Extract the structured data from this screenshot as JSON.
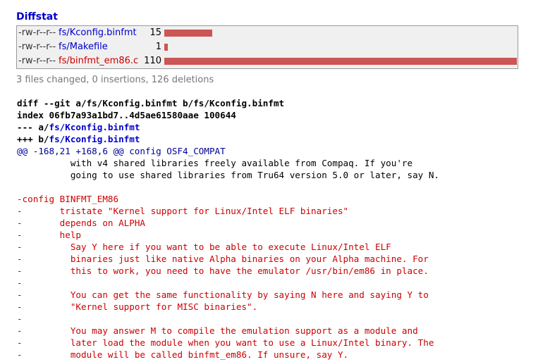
{
  "diffstat": {
    "heading": "Diffstat",
    "max_count": 110,
    "rows": [
      {
        "mode": "-rw-r--r--",
        "file": "fs/Kconfig.binfmt",
        "count": "15",
        "deleted_file": false
      },
      {
        "mode": "-rw-r--r--",
        "file": "fs/Makefile",
        "count": "1",
        "deleted_file": false
      },
      {
        "mode": "-rw-r--r--",
        "file": "fs/binfmt_em86.c",
        "count": "110",
        "deleted_file": true
      }
    ],
    "bar_color": "#cc5555",
    "summary": "3 files changed, 0 insertions, 126 deletions"
  },
  "diff": {
    "header_line": "diff --git a/fs/Kconfig.binfmt b/fs/Kconfig.binfmt",
    "index_line": "index 06fb7a93a1bd7..4d5ae61580aae 100644",
    "minus_prefix": "--- a/",
    "minus_path": "fs/Kconfig.binfmt",
    "plus_prefix": "+++ b/",
    "plus_path": "fs/Kconfig.binfmt",
    "hunk": "@@ -168,21 +168,6 @@ config OSF4_COMPAT",
    "lines": [
      {
        "kind": "ctx",
        "text": "\t  with v4 shared libraries freely available from Compaq. If you're"
      },
      {
        "kind": "ctx",
        "text": "\t  going to use shared libraries from Tru64 version 5.0 or later, say N."
      },
      {
        "kind": "ctx",
        "text": " "
      },
      {
        "kind": "del",
        "text": "-config BINFMT_EM86"
      },
      {
        "kind": "del",
        "text": "-\ttristate \"Kernel support for Linux/Intel ELF binaries\""
      },
      {
        "kind": "del",
        "text": "-\tdepends on ALPHA"
      },
      {
        "kind": "del",
        "text": "-\thelp"
      },
      {
        "kind": "del",
        "text": "-\t  Say Y here if you want to be able to execute Linux/Intel ELF"
      },
      {
        "kind": "del",
        "text": "-\t  binaries just like native Alpha binaries on your Alpha machine. For"
      },
      {
        "kind": "del",
        "text": "-\t  this to work, you need to have the emulator /usr/bin/em86 in place."
      },
      {
        "kind": "del",
        "text": "-"
      },
      {
        "kind": "del",
        "text": "-\t  You can get the same functionality by saying N here and saying Y to"
      },
      {
        "kind": "del",
        "text": "-\t  \"Kernel support for MISC binaries\"."
      },
      {
        "kind": "del",
        "text": "-"
      },
      {
        "kind": "del",
        "text": "-\t  You may answer M to compile the emulation support as a module and"
      },
      {
        "kind": "del",
        "text": "-\t  later load the module when you want to use a Linux/Intel binary. The"
      },
      {
        "kind": "del",
        "text": "-\t  module will be called binfmt_em86. If unsure, say Y."
      }
    ]
  }
}
